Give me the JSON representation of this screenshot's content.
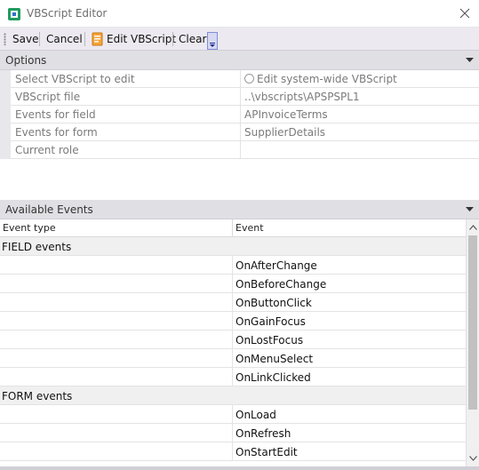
{
  "window": {
    "title": "VBScript Editor"
  },
  "toolbar": {
    "save_label": "Save",
    "cancel_label": "Cancel",
    "edit_label": "Edit VBScript",
    "clear_label": "Clear"
  },
  "options": {
    "header": "Options",
    "rows": [
      {
        "name": "Select VBScript to edit",
        "value": "Edit system-wide VBScript"
      },
      {
        "name": "VBScript file",
        "value": "..\\vbscripts\\APSPSPL1"
      },
      {
        "name": "Events for field",
        "value": "APInvoiceTerms"
      },
      {
        "name": "Events for form",
        "value": "SupplierDetails"
      },
      {
        "name": "Current role",
        "value": ""
      }
    ]
  },
  "events": {
    "header": "Available Events",
    "columns": {
      "type": "Event type",
      "event": "Event"
    },
    "rows": [
      {
        "type": "FIELD events",
        "event": ""
      },
      {
        "type": "",
        "event": "OnAfterChange"
      },
      {
        "type": "",
        "event": "OnBeforeChange"
      },
      {
        "type": "",
        "event": "OnButtonClick"
      },
      {
        "type": "",
        "event": "OnGainFocus"
      },
      {
        "type": "",
        "event": "OnLostFocus"
      },
      {
        "type": "",
        "event": "OnMenuSelect"
      },
      {
        "type": "",
        "event": "OnLinkClicked"
      },
      {
        "type": "FORM events",
        "event": ""
      },
      {
        "type": "",
        "event": "OnLoad"
      },
      {
        "type": "",
        "event": "OnRefresh"
      },
      {
        "type": "",
        "event": "OnStartEdit"
      }
    ]
  },
  "icons": {
    "app": "vbscript-app-icon",
    "close": "close-icon",
    "edit": "edit-script-icon",
    "collapse": "chevron-down-icon"
  },
  "colors": {
    "toolbar_bg": "#eceaf0",
    "section_bg": "#e0dfe4",
    "muted_text": "#7b7b7b",
    "group_row_bg": "#f0f0f0"
  }
}
